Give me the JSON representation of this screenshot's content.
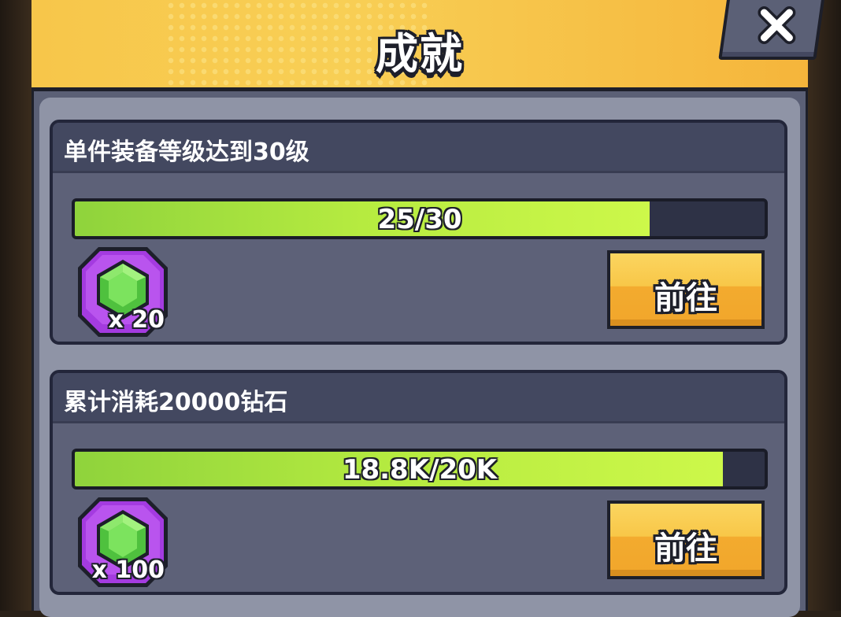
{
  "window": {
    "title": "成就",
    "close_icon": "close-icon"
  },
  "colors": {
    "header": "#f8c748",
    "panel": "#5b6076",
    "progress_fill": "#b6eb40",
    "button": "#f8c748",
    "reward_frame": "#a43be0",
    "gem": "#5fd14a"
  },
  "achievements": [
    {
      "title": "单件装备等级达到30级",
      "progress_text": "25/30",
      "progress_fraction": 0.833,
      "reward_icon": "green-gem-icon",
      "reward_qty": "x 20",
      "button_label": "前往"
    },
    {
      "title": "累计消耗20000钻石",
      "progress_text": "18.8K/20K",
      "progress_fraction": 0.94,
      "reward_icon": "green-gem-icon",
      "reward_qty": "x 100",
      "button_label": "前往"
    }
  ]
}
